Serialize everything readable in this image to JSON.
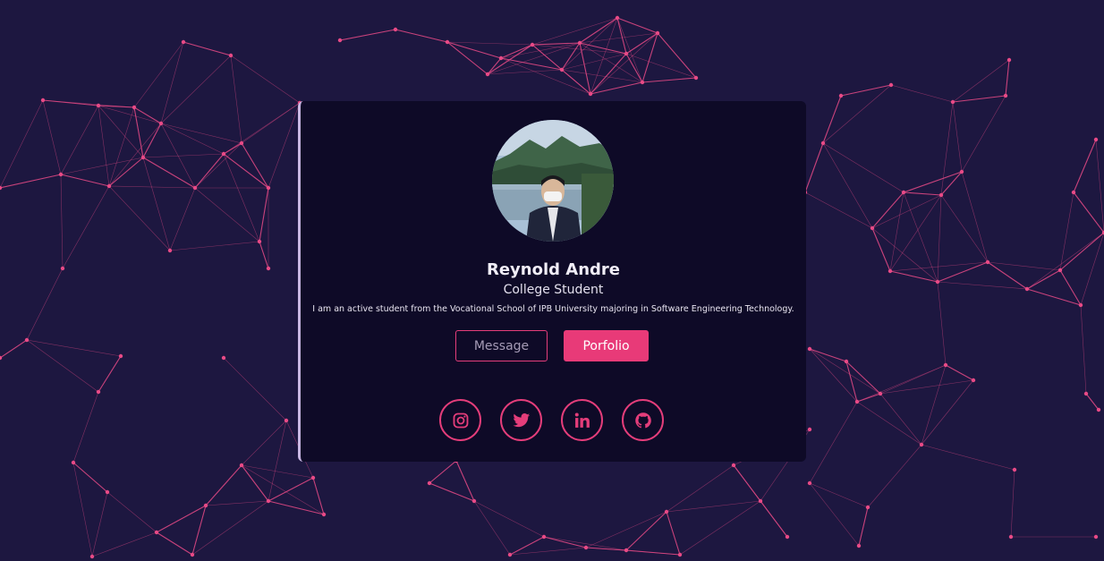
{
  "colors": {
    "background": "#1d1740",
    "card": "#0e0a27",
    "accent": "#e83a78",
    "network_line": "#e84a86",
    "text": "#f1eef8"
  },
  "profile": {
    "avatar_icon": "profile-photo",
    "name": "Reynold Andre",
    "role": "College Student",
    "bio": "I am an active student from the Vocational School of IPB University majoring in Software Engineering Technology."
  },
  "actions": {
    "message_label": "Message",
    "portfolio_label": "Porfolio"
  },
  "social_links": [
    {
      "icon": "instagram-icon"
    },
    {
      "icon": "twitter-icon"
    },
    {
      "icon": "linkedin-icon"
    },
    {
      "icon": "github-icon"
    }
  ]
}
